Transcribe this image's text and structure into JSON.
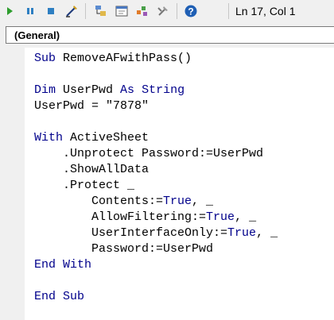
{
  "toolbar": {
    "items": [
      {
        "name": "run-icon",
        "label": "Run Sub/UserForm"
      },
      {
        "name": "pause-icon",
        "label": "Break"
      },
      {
        "name": "stop-icon",
        "label": "Reset"
      },
      {
        "name": "design-mode-icon",
        "label": "Design Mode"
      },
      {
        "name": "project-explorer-icon",
        "label": "Project Explorer"
      },
      {
        "name": "properties-window-icon",
        "label": "Properties Window"
      },
      {
        "name": "object-browser-icon",
        "label": "Object Browser"
      },
      {
        "name": "toolbox-icon",
        "label": "Toolbox"
      },
      {
        "name": "help-icon",
        "label": "Help"
      }
    ],
    "position_text": "Ln 17, Col 1"
  },
  "procedure_combo": {
    "value": "(General)"
  },
  "colors": {
    "keyword": "#00008b",
    "text": "#000000",
    "toolbar_bg": "#f0f0f0",
    "run_green": "#2e9e2e",
    "pause_blue": "#2e7fc2",
    "stop_blue": "#2e7fc2"
  },
  "code": {
    "lines": [
      [
        {
          "t": "Sub",
          "k": 1
        },
        {
          "t": " RemoveAFwithPass()"
        }
      ],
      [],
      [
        {
          "t": "Dim",
          "k": 1
        },
        {
          "t": " UserPwd "
        },
        {
          "t": "As",
          "k": 1
        },
        {
          "t": " "
        },
        {
          "t": "String",
          "k": 1
        }
      ],
      [
        {
          "t": "UserPwd = \"7878\""
        }
      ],
      [],
      [
        {
          "t": "With",
          "k": 1
        },
        {
          "t": " ActiveSheet"
        }
      ],
      [
        {
          "t": "    .Unprotect Password:=UserPwd"
        }
      ],
      [
        {
          "t": "    .ShowAllData"
        }
      ],
      [
        {
          "t": "    .Protect _"
        }
      ],
      [
        {
          "t": "        Contents:="
        },
        {
          "t": "True",
          "k": 1
        },
        {
          "t": ", _"
        }
      ],
      [
        {
          "t": "        AllowFiltering:="
        },
        {
          "t": "True",
          "k": 1
        },
        {
          "t": ", _"
        }
      ],
      [
        {
          "t": "        UserInterfaceOnly:="
        },
        {
          "t": "True",
          "k": 1
        },
        {
          "t": ", _"
        }
      ],
      [
        {
          "t": "        Password:=UserPwd"
        }
      ],
      [
        {
          "t": "End",
          "k": 1
        },
        {
          "t": " "
        },
        {
          "t": "With",
          "k": 1
        }
      ],
      [],
      [
        {
          "t": "End",
          "k": 1
        },
        {
          "t": " "
        },
        {
          "t": "Sub",
          "k": 1
        }
      ]
    ]
  }
}
